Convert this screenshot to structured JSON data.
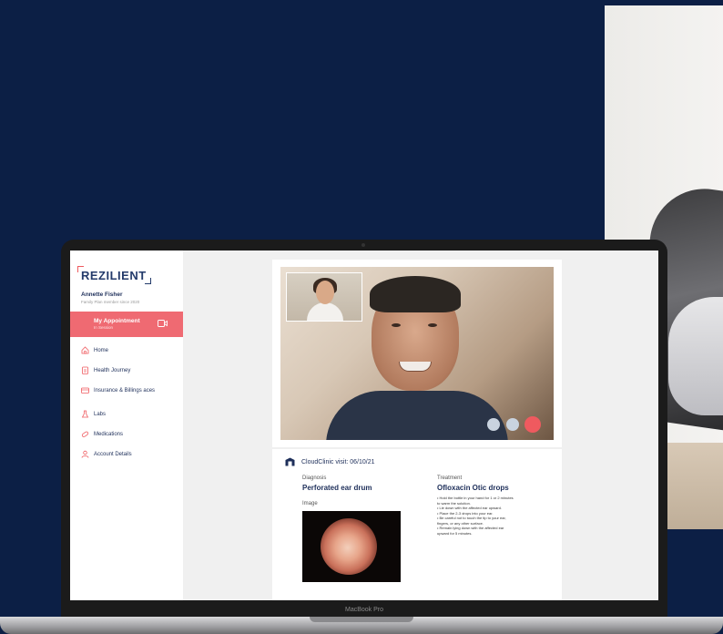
{
  "app": {
    "logo": "REZILIENT",
    "user_name": "Annette Fisher",
    "user_subtitle": "Family Plan member since 2020"
  },
  "appointment": {
    "title": "My Appointment",
    "status": "In Session"
  },
  "nav": [
    {
      "label": "Home",
      "icon": "home-icon"
    },
    {
      "label": "Health Journey",
      "icon": "clipboard-icon"
    },
    {
      "label": "Insurance & Billings aces",
      "icon": "card-icon"
    },
    {
      "label": "Labs",
      "icon": "flask-icon"
    },
    {
      "label": "Medications",
      "icon": "pill-icon"
    },
    {
      "label": "Account Details",
      "icon": "user-icon"
    }
  ],
  "visit": {
    "title": "CloudClinic visit: 06/10/21",
    "diagnosis_label": "Diagnosis",
    "diagnosis": "Perforated ear drum",
    "image_label": "Image",
    "treatment_label": "Treatment",
    "treatment": "Ofloxacin Otic drops",
    "instructions": [
      "• Hold the bottle in your hand for 1 or 2 minutes",
      "to warm the solution.",
      "• Lie down with the affected ear upward.",
      "• Place the 2-3 drops into your ear.",
      "• Be careful not to touch the tip to your ear,",
      "fingers, or any other surface.",
      "• Remain lying down with the affected ear",
      "upward for 5 minutes."
    ]
  },
  "video_controls": {
    "colors": [
      "#c9d3df",
      "#c9d3df",
      "#ef5a5f"
    ]
  },
  "device_label": "MacBook Pro"
}
